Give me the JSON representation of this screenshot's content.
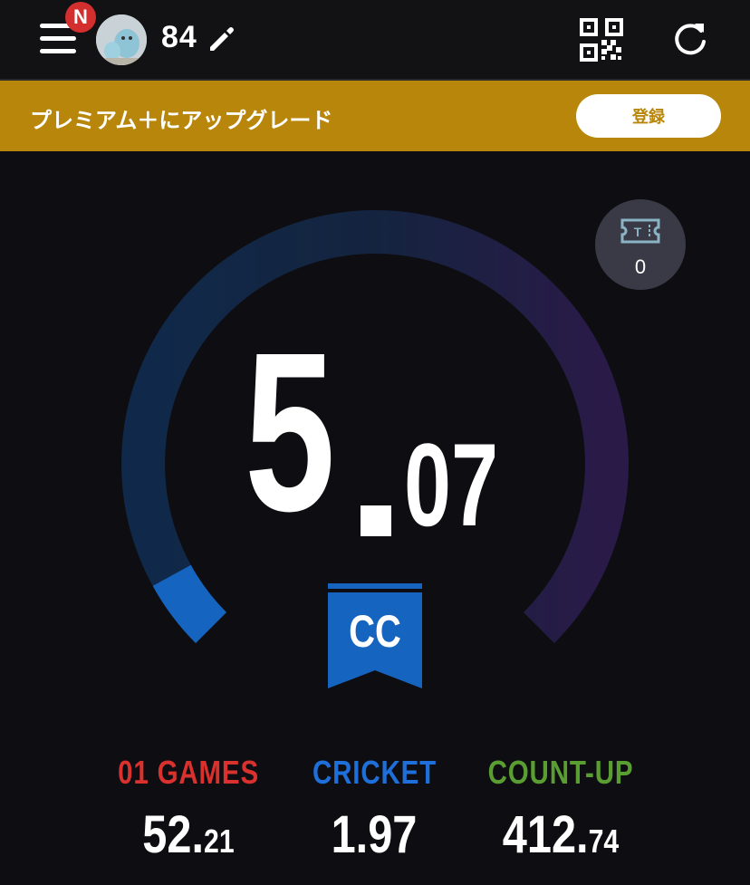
{
  "header": {
    "notification_badge": "N",
    "username": "84",
    "icons": [
      "menu-icon",
      "pencil-icon",
      "qr-code-icon",
      "refresh-icon"
    ]
  },
  "banner": {
    "text": "プレミアム＋にアップグレード",
    "button_label": "登録"
  },
  "ticket": {
    "icon": "ticket-icon",
    "count": "0"
  },
  "rating": {
    "integer": "5",
    "decimal": "07",
    "value": 5.07,
    "class": "CC",
    "progress_fraction": 0.06
  },
  "stats": [
    {
      "label": "01 GAMES",
      "value_int": "52.",
      "value_dec": "21",
      "color": "#d9312d"
    },
    {
      "label": "CRICKET",
      "value_int": "1.97",
      "value_dec": "",
      "color": "#1e6fd9"
    },
    {
      "label": "COUNT-UP",
      "value_int": "412.",
      "value_dec": "74",
      "color": "#5a9e32"
    }
  ],
  "colors": {
    "banner": "#b8860b",
    "badge": "#d32f2f",
    "gauge_fill": "#1565c0",
    "ribbon": "#1565c0"
  }
}
